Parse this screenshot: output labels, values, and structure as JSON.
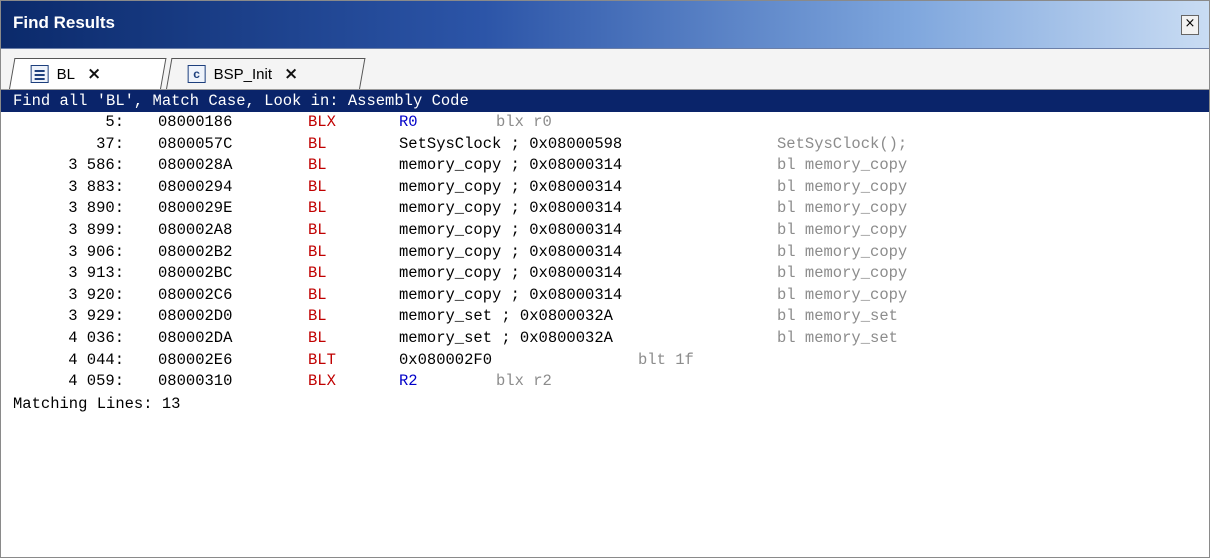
{
  "window": {
    "title": "Find Results",
    "close_glyph": "×"
  },
  "tabs": [
    {
      "label": "BL",
      "icon": "document-list-icon",
      "close": "×"
    },
    {
      "label": "BSP_Init",
      "icon": "c-file-icon",
      "icon_text": "c",
      "close": "×"
    }
  ],
  "results": {
    "header": "Find all 'BL', Match Case, Look in: Assembly Code",
    "rows": [
      {
        "line": "5:",
        "addr": "08000186",
        "op": "BLX",
        "arg": "R0",
        "src": "blx r0"
      },
      {
        "line": "37:",
        "addr": "0800057C",
        "op": "BL",
        "arg": "SetSysClock ; 0x08000598",
        "src": "SetSysClock();"
      },
      {
        "line": "3 586:",
        "addr": "0800028A",
        "op": "BL",
        "arg": "memory_copy ; 0x08000314",
        "src": "bl memory_copy"
      },
      {
        "line": "3 883:",
        "addr": "08000294",
        "op": "BL",
        "arg": "memory_copy ; 0x08000314",
        "src": "bl memory_copy"
      },
      {
        "line": "3 890:",
        "addr": "0800029E",
        "op": "BL",
        "arg": "memory_copy ; 0x08000314",
        "src": "bl memory_copy"
      },
      {
        "line": "3 899:",
        "addr": "080002A8",
        "op": "BL",
        "arg": "memory_copy ; 0x08000314",
        "src": "bl memory_copy"
      },
      {
        "line": "3 906:",
        "addr": "080002B2",
        "op": "BL",
        "arg": "memory_copy ; 0x08000314",
        "src": "bl memory_copy"
      },
      {
        "line": "3 913:",
        "addr": "080002BC",
        "op": "BL",
        "arg": "memory_copy ; 0x08000314",
        "src": "bl memory_copy"
      },
      {
        "line": "3 920:",
        "addr": "080002C6",
        "op": "BL",
        "arg": "memory_copy ; 0x08000314",
        "src": "bl memory_copy"
      },
      {
        "line": "3 929:",
        "addr": "080002D0",
        "op": "BL",
        "arg": "memory_set ; 0x0800032A",
        "src": "bl memory_set"
      },
      {
        "line": "4 036:",
        "addr": "080002DA",
        "op": "BL",
        "arg": "memory_set ; 0x0800032A",
        "src": "bl memory_set"
      },
      {
        "line": "4 044:",
        "addr": "080002E6",
        "op": "BLT",
        "arg": "0x080002F0",
        "src": "blt 1f"
      },
      {
        "line": "4 059:",
        "addr": "08000310",
        "op": "BLX",
        "arg": "R2",
        "src": "blx r2"
      }
    ],
    "summary": "Matching Lines: 13"
  },
  "colors": {
    "header_bg": "#0a246a",
    "opcode": "#c00000",
    "register": "#0000c8",
    "source_comment": "#8c8c8c"
  }
}
